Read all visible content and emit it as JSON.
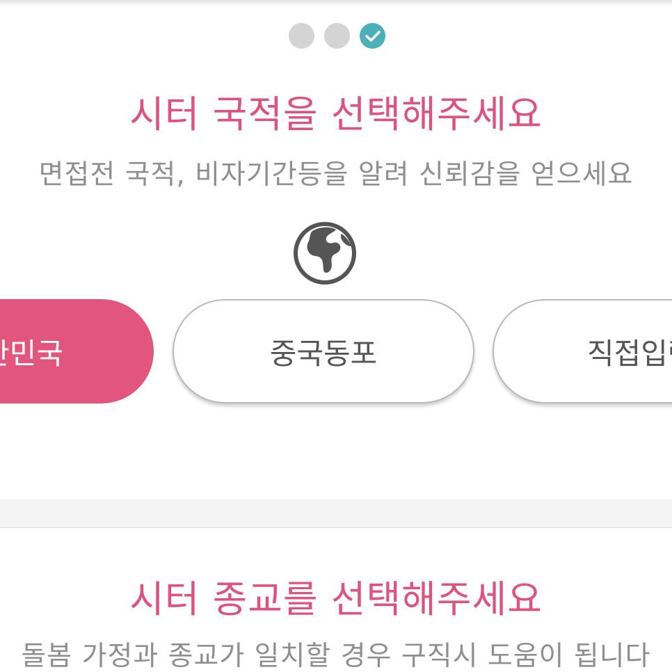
{
  "progress": {
    "steps": [
      "pending",
      "pending",
      "done"
    ],
    "done_icon": "check-icon"
  },
  "colors": {
    "accent": "#e0517b",
    "chip_selected": "#e2567d",
    "step_done": "#4cb0b9",
    "step_pending": "#d4d4d4",
    "subtitle": "#8f8f8f"
  },
  "nationality": {
    "title": "시터 국적을 선택해주세요",
    "subtitle": "면접전 국적, 비자기간등을 알려 신뢰감을 얻으세요",
    "icon": "globe-icon",
    "options": [
      {
        "label": "대한민국",
        "selected": true
      },
      {
        "label": "중국동포",
        "selected": false
      },
      {
        "label": "직접입력",
        "selected": false
      }
    ]
  },
  "religion": {
    "title": "시터 종교를 선택해주세요",
    "subtitle": "돌봄 가정과 종교가 일치할 경우 구직시 도움이 됩니다"
  }
}
